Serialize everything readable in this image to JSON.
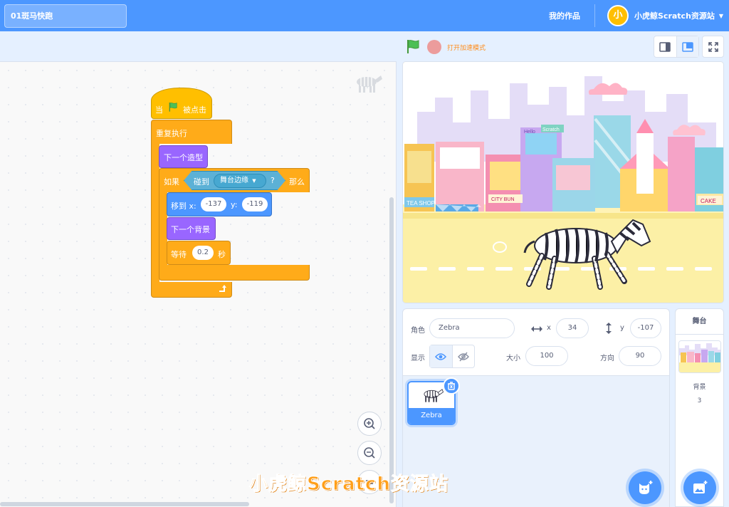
{
  "header": {
    "project_title": "01斑马快跑",
    "my_works": "我的作品",
    "account_name": "小虎鲸Scratch资源站",
    "avatar_text": "小"
  },
  "controls": {
    "turbo_label": "打开加速模式"
  },
  "blocks": {
    "when_flag_prefix": "当",
    "when_flag_suffix": "被点击",
    "forever": "重复执行",
    "next_costume": "下一个造型",
    "if_label": "如果",
    "then_label": "那么",
    "touching": "碰到",
    "touching_option": "舞台边缘",
    "question": "?",
    "goto_label": "移到 x:",
    "goto_x": "-137",
    "goto_y_label": "y:",
    "goto_y": "-119",
    "next_backdrop": "下一个背景",
    "wait_label": "等待",
    "wait_value": "0.2",
    "wait_unit": "秒"
  },
  "sprite_info": {
    "sprite_label": "角色",
    "sprite_name": "Zebra",
    "x_label": "x",
    "x_value": "34",
    "y_label": "y",
    "y_value": "-107",
    "show_label": "显示",
    "size_label": "大小",
    "size_value": "100",
    "direction_label": "方向",
    "direction_value": "90"
  },
  "sprites": [
    {
      "name": "Zebra"
    }
  ],
  "stage_panel": {
    "title": "舞台",
    "backdrops_label": "背景",
    "backdrops_count": "3"
  },
  "stage_scene": {
    "sign_tea_shop": "TEA SHOP",
    "sign_city_bun": "CITY BUN",
    "sign_cake": "CAKE",
    "sign_hello": "Hello",
    "sign_scratch": "Scratch"
  },
  "watermark": "小虎鲸Scratch资源站",
  "colors": {
    "menu_blue": "#4c97ff",
    "control_orange": "#ffab19",
    "looks_purple": "#9966ff",
    "motion_blue": "#4c97ff",
    "sensing_cyan": "#5cb1d6",
    "events_yellow": "#ffbf00"
  }
}
